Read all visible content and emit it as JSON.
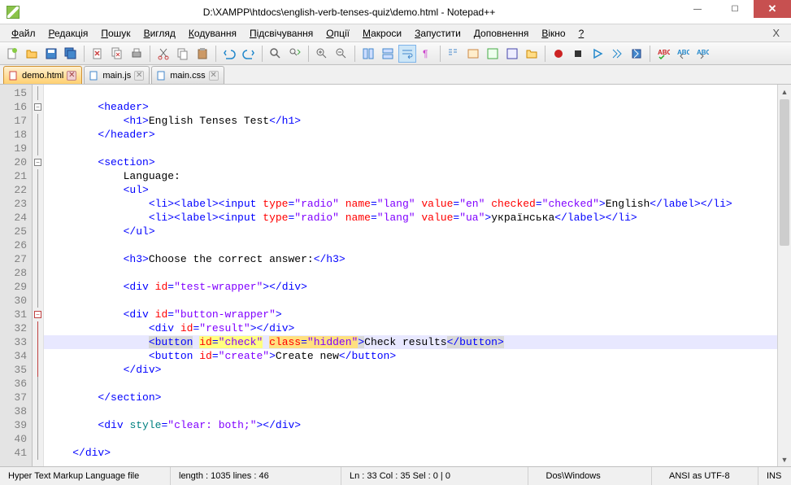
{
  "window": {
    "title": "D:\\XAMPP\\htdocs\\english-verb-tenses-quiz\\demo.html - Notepad++"
  },
  "menu": {
    "items": [
      "Файл",
      "Редакція",
      "Пошук",
      "Вигляд",
      "Кодування",
      "Підсвічування",
      "Опції",
      "Макроси",
      "Запустити",
      "Доповнення",
      "Вікно",
      "?"
    ]
  },
  "tabs": [
    {
      "label": "demo.html",
      "active": true
    },
    {
      "label": "main.js",
      "active": false
    },
    {
      "label": "main.css",
      "active": false
    }
  ],
  "editor": {
    "first_line": 15,
    "highlighted_line": 33,
    "lines": [
      {
        "n": 15,
        "indent": 0,
        "tokens": []
      },
      {
        "n": 16,
        "indent": 8,
        "tokens": [
          {
            "t": "tag",
            "v": "<header>"
          }
        ]
      },
      {
        "n": 17,
        "indent": 12,
        "tokens": [
          {
            "t": "tag",
            "v": "<h1>"
          },
          {
            "t": "text",
            "v": "English Tenses Test"
          },
          {
            "t": "tag",
            "v": "</h1>"
          }
        ]
      },
      {
        "n": 18,
        "indent": 8,
        "tokens": [
          {
            "t": "tag",
            "v": "</header>"
          }
        ]
      },
      {
        "n": 19,
        "indent": 0,
        "tokens": []
      },
      {
        "n": 20,
        "indent": 8,
        "tokens": [
          {
            "t": "tag",
            "v": "<section>"
          }
        ]
      },
      {
        "n": 21,
        "indent": 12,
        "tokens": [
          {
            "t": "text",
            "v": "Language:"
          }
        ]
      },
      {
        "n": 22,
        "indent": 12,
        "tokens": [
          {
            "t": "tag",
            "v": "<ul>"
          }
        ]
      },
      {
        "n": 23,
        "indent": 16,
        "tokens": [
          {
            "t": "tag",
            "v": "<li><label><input"
          },
          {
            "t": "text",
            "v": " "
          },
          {
            "t": "attr-name",
            "v": "type"
          },
          {
            "t": "tag",
            "v": "="
          },
          {
            "t": "attr-val",
            "v": "\"radio\""
          },
          {
            "t": "text",
            "v": " "
          },
          {
            "t": "attr-name",
            "v": "name"
          },
          {
            "t": "tag",
            "v": "="
          },
          {
            "t": "attr-val",
            "v": "\"lang\""
          },
          {
            "t": "text",
            "v": " "
          },
          {
            "t": "attr-name",
            "v": "value"
          },
          {
            "t": "tag",
            "v": "="
          },
          {
            "t": "attr-val",
            "v": "\"en\""
          },
          {
            "t": "text",
            "v": " "
          },
          {
            "t": "attr-name",
            "v": "checked"
          },
          {
            "t": "tag",
            "v": "="
          },
          {
            "t": "attr-val",
            "v": "\"checked\""
          },
          {
            "t": "tag",
            "v": ">"
          },
          {
            "t": "text",
            "v": "English"
          },
          {
            "t": "tag",
            "v": "</label></li>"
          }
        ]
      },
      {
        "n": 24,
        "indent": 16,
        "tokens": [
          {
            "t": "tag",
            "v": "<li><label><input"
          },
          {
            "t": "text",
            "v": " "
          },
          {
            "t": "attr-name",
            "v": "type"
          },
          {
            "t": "tag",
            "v": "="
          },
          {
            "t": "attr-val",
            "v": "\"radio\""
          },
          {
            "t": "text",
            "v": " "
          },
          {
            "t": "attr-name",
            "v": "name"
          },
          {
            "t": "tag",
            "v": "="
          },
          {
            "t": "attr-val",
            "v": "\"lang\""
          },
          {
            "t": "text",
            "v": " "
          },
          {
            "t": "attr-name",
            "v": "value"
          },
          {
            "t": "tag",
            "v": "="
          },
          {
            "t": "attr-val",
            "v": "\"ua\""
          },
          {
            "t": "tag",
            "v": ">"
          },
          {
            "t": "text",
            "v": "українська"
          },
          {
            "t": "tag",
            "v": "</label></li>"
          }
        ]
      },
      {
        "n": 25,
        "indent": 12,
        "tokens": [
          {
            "t": "tag",
            "v": "</ul>"
          }
        ]
      },
      {
        "n": 26,
        "indent": 0,
        "tokens": []
      },
      {
        "n": 27,
        "indent": 12,
        "tokens": [
          {
            "t": "tag",
            "v": "<h3>"
          },
          {
            "t": "text",
            "v": "Choose the correct answer:"
          },
          {
            "t": "tag",
            "v": "</h3>"
          }
        ]
      },
      {
        "n": 28,
        "indent": 0,
        "tokens": []
      },
      {
        "n": 29,
        "indent": 12,
        "tokens": [
          {
            "t": "tag",
            "v": "<div"
          },
          {
            "t": "text",
            "v": " "
          },
          {
            "t": "attr-name",
            "v": "id"
          },
          {
            "t": "tag",
            "v": "="
          },
          {
            "t": "attr-val",
            "v": "\"test-wrapper\""
          },
          {
            "t": "tag",
            "v": "></div>"
          }
        ]
      },
      {
        "n": 30,
        "indent": 0,
        "tokens": []
      },
      {
        "n": 31,
        "indent": 12,
        "tokens": [
          {
            "t": "tag",
            "v": "<div"
          },
          {
            "t": "text",
            "v": " "
          },
          {
            "t": "attr-name",
            "v": "id"
          },
          {
            "t": "tag",
            "v": "="
          },
          {
            "t": "attr-val",
            "v": "\"button-wrapper\""
          },
          {
            "t": "tag",
            "v": ">"
          }
        ]
      },
      {
        "n": 32,
        "indent": 16,
        "tokens": [
          {
            "t": "tag",
            "v": "<div"
          },
          {
            "t": "text",
            "v": " "
          },
          {
            "t": "attr-name",
            "v": "id"
          },
          {
            "t": "tag",
            "v": "="
          },
          {
            "t": "attr-val",
            "v": "\"result\""
          },
          {
            "t": "tag",
            "v": "></div>"
          }
        ]
      },
      {
        "n": 33,
        "indent": 16,
        "hl": true,
        "tokens": [
          {
            "t": "tag",
            "v": "<button",
            "bg": "hl-tag"
          },
          {
            "t": "text",
            "v": " "
          },
          {
            "t": "attr-name",
            "v": "id",
            "bg": "hl-y1"
          },
          {
            "t": "tag",
            "v": "=",
            "bg": "hl-y1"
          },
          {
            "t": "attr-val",
            "v": "\"check\"",
            "bg": "hl-y1"
          },
          {
            "t": "text",
            "v": " "
          },
          {
            "t": "attr-name",
            "v": "class",
            "bg": "hl-y2"
          },
          {
            "t": "tag",
            "v": "=",
            "bg": "hl-y2"
          },
          {
            "t": "attr-val",
            "v": "\"hidden\"",
            "bg": "hl-y2"
          },
          {
            "t": "tag",
            "v": ">",
            "bg": "hl-tag"
          },
          {
            "t": "text",
            "v": "Check results"
          },
          {
            "t": "tag",
            "v": "</button>",
            "bg": "hl-tag"
          }
        ]
      },
      {
        "n": 34,
        "indent": 16,
        "tokens": [
          {
            "t": "tag",
            "v": "<button"
          },
          {
            "t": "text",
            "v": " "
          },
          {
            "t": "attr-name",
            "v": "id"
          },
          {
            "t": "tag",
            "v": "="
          },
          {
            "t": "attr-val",
            "v": "\"create\""
          },
          {
            "t": "tag",
            "v": ">"
          },
          {
            "t": "text",
            "v": "Create new"
          },
          {
            "t": "tag",
            "v": "</button>"
          }
        ]
      },
      {
        "n": 35,
        "indent": 12,
        "tokens": [
          {
            "t": "tag",
            "v": "</div>"
          }
        ]
      },
      {
        "n": 36,
        "indent": 0,
        "tokens": []
      },
      {
        "n": 37,
        "indent": 8,
        "tokens": [
          {
            "t": "tag",
            "v": "</section>"
          }
        ]
      },
      {
        "n": 38,
        "indent": 0,
        "tokens": []
      },
      {
        "n": 39,
        "indent": 8,
        "tokens": [
          {
            "t": "tag",
            "v": "<div"
          },
          {
            "t": "text",
            "v": " "
          },
          {
            "t": "style-attr",
            "v": "style"
          },
          {
            "t": "tag",
            "v": "="
          },
          {
            "t": "attr-val",
            "v": "\"clear: both;\""
          },
          {
            "t": "tag",
            "v": "></div>"
          }
        ]
      },
      {
        "n": 40,
        "indent": 0,
        "tokens": []
      },
      {
        "n": 41,
        "indent": 4,
        "tokens": [
          {
            "t": "tag",
            "v": "</div>"
          }
        ]
      }
    ],
    "fold": {
      "16": "minus",
      "20": "minus",
      "31": "minus-red"
    }
  },
  "status": {
    "filetype": "Hyper Text Markup Language file",
    "length": "length : 1035    lines : 46",
    "position": "Ln : 33    Col : 35    Sel : 0 | 0",
    "eol": "Dos\\Windows",
    "encoding": "ANSI as UTF-8",
    "mode": "INS"
  }
}
